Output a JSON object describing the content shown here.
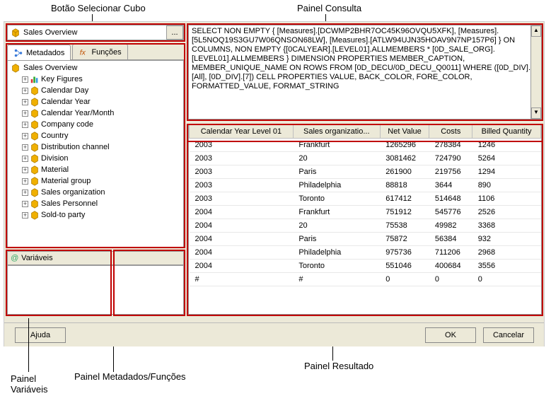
{
  "annotations": {
    "cube_button": "Botão Selecionar Cubo",
    "query_panel": "Painel Consulta",
    "metadata_panel": "Painel Metadados/Funções",
    "vars_panel": "Painel\nVariáveis",
    "result_panel": "Painel Resultado"
  },
  "cube": {
    "label": "Sales Overview",
    "button": "..."
  },
  "tabs": {
    "metadata": "Metadados",
    "functions": "Funções"
  },
  "tree": {
    "root": "Sales Overview",
    "items": [
      "Key Figures",
      "Calendar Day",
      "Calendar Year",
      "Calendar Year/Month",
      "Company code",
      "Country",
      "Distribution channel",
      "Division",
      "Material",
      "Material group",
      "Sales organization",
      "Sales Personnel",
      "Sold-to party"
    ]
  },
  "vars": {
    "header": "Variáveis"
  },
  "query_text": "SELECT NON EMPTY { [Measures].[DCWMP2BHR7OC45K96OVQU5XFK], [Measures].[5L5NOQ19S3GU7W06QNSON68LW], [Measures].[ATLW94UJN35HOAV9N7NP157P6] } ON COLUMNS, NON EMPTY {[0CALYEAR].[LEVEL01].ALLMEMBERS * [0D_SALE_ORG].[LEVEL01].ALLMEMBERS } DIMENSION PROPERTIES MEMBER_CAPTION, MEMBER_UNIQUE_NAME ON ROWS FROM [0D_DECU/0D_DECU_Q0011] WHERE ([0D_DIV].[All], [0D_DIV].[7]) CELL PROPERTIES VALUE, BACK_COLOR, FORE_COLOR, FORMATTED_VALUE, FORMAT_STRING",
  "result": {
    "columns": [
      "Calendar Year Level 01",
      "Sales organizatio...",
      "Net Value",
      "Costs",
      "Billed Quantity"
    ],
    "rows": [
      [
        "2003",
        "Frankfurt",
        "1265296",
        "278384",
        "1246"
      ],
      [
        "2003",
        "20",
        "3081462",
        "724790",
        "5264"
      ],
      [
        "2003",
        "Paris",
        "261900",
        "219756",
        "1294"
      ],
      [
        "2003",
        "Philadelphia",
        "88818",
        "3644",
        "890"
      ],
      [
        "2003",
        "Toronto",
        "617412",
        "514648",
        "1106"
      ],
      [
        "2004",
        "Frankfurt",
        "751912",
        "545776",
        "2526"
      ],
      [
        "2004",
        "20",
        "75538",
        "49982",
        "3368"
      ],
      [
        "2004",
        "Paris",
        "75872",
        "56384",
        "932"
      ],
      [
        "2004",
        "Philadelphia",
        "975736",
        "711206",
        "2968"
      ],
      [
        "2004",
        "Toronto",
        "551046",
        "400684",
        "3556"
      ],
      [
        "#",
        "#",
        "0",
        "0",
        "0"
      ]
    ]
  },
  "buttons": {
    "help": "Ajuda",
    "ok": "OK",
    "cancel": "Cancelar"
  }
}
